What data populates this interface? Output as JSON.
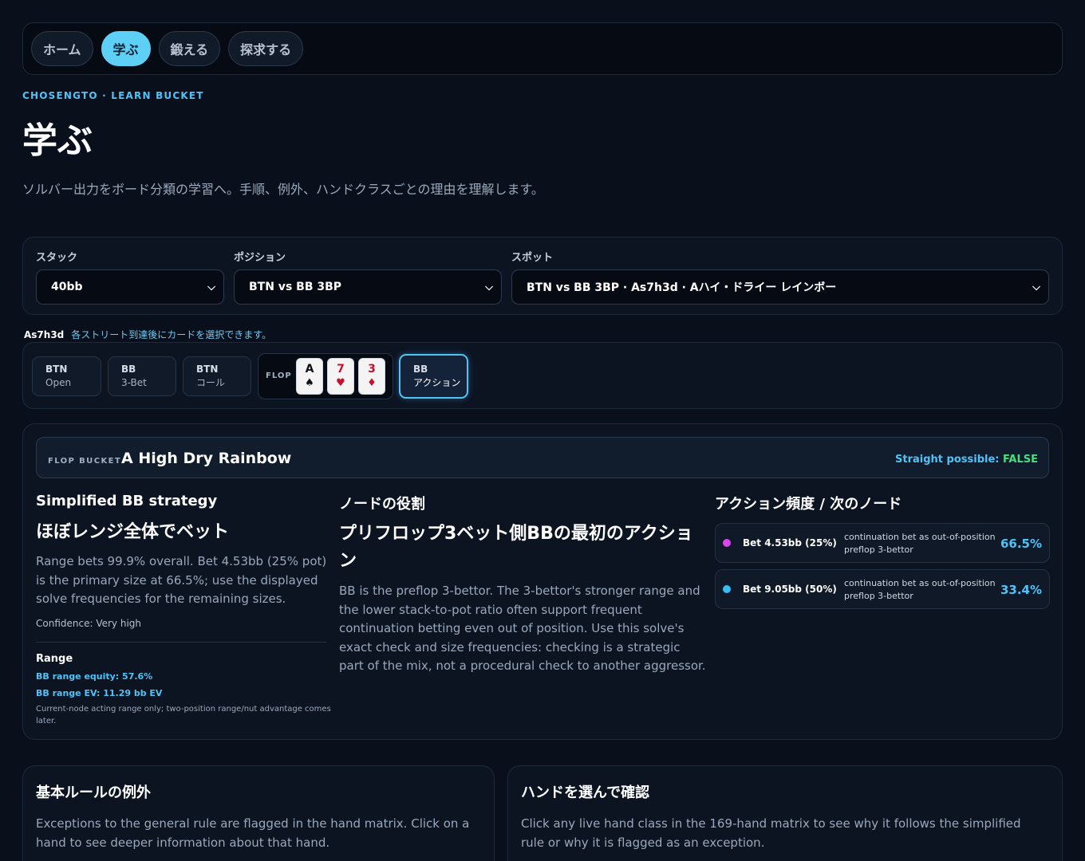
{
  "nav": {
    "items": [
      {
        "label": "ホーム",
        "active": false
      },
      {
        "label": "学ぶ",
        "active": true
      },
      {
        "label": "鍛える",
        "active": false
      },
      {
        "label": "探求する",
        "active": false
      }
    ]
  },
  "header": {
    "eyebrow": "CHOSENGTO · LEARN BUCKET",
    "title": "学ぶ",
    "subtitle": "ソルバー出力をボード分類の学習へ。手順、例外、ハンドクラスごとの理由を理解します。"
  },
  "selectors": {
    "stack": {
      "label": "スタック",
      "value": "40bb"
    },
    "position": {
      "label": "ポジション",
      "value": "BTN vs BB 3BP"
    },
    "spot": {
      "label": "スポット",
      "value": "BTN vs BB 3BP · As7h3d · Aハイ・ドライー レインボー"
    }
  },
  "street": {
    "board": "As7h3d",
    "hint": "各ストリート到達後にカードを選択できます。"
  },
  "trail": {
    "steps": [
      {
        "position": "BTN",
        "action": "Open"
      },
      {
        "position": "BB",
        "action": "3-Bet"
      },
      {
        "position": "BTN",
        "action": "コール"
      }
    ],
    "flop_label": "FLOP",
    "flop_cards": [
      {
        "rank": "A",
        "suit": "♠",
        "color": "black"
      },
      {
        "rank": "7",
        "suit": "♥",
        "color": "red"
      },
      {
        "rank": "3",
        "suit": "♦",
        "color": "red"
      }
    ],
    "current": {
      "position": "BB",
      "action": "アクション"
    }
  },
  "bucket": {
    "kicker": "FLOP BUCKET",
    "name": "A High Dry Rainbow",
    "straight_label": "Straight possible:",
    "straight_value": "FALSE"
  },
  "strategy": {
    "heading": "Simplified BB strategy",
    "headline": "ほぼレンジ全体でベット",
    "body": "Range bets 99.9% overall. Bet 4.53bb (25% pot) is the primary size at 66.5%; use the displayed solve frequencies for the remaining sizes.",
    "confidence": "Confidence: Very high",
    "range_heading": "Range",
    "equity": "BB range equity: 57.6%",
    "ev": "BB range EV: 11.29 bb EV",
    "range_note": "Current-node acting range only; two-position range/nut advantage comes later."
  },
  "node_role": {
    "heading": "ノードの役割",
    "headline": "プリフロップ3ベット側BBの最初のアクション",
    "body": "BB is the preflop 3-bettor. The 3-bettor's stronger range and the lower stack-to-pot ratio often support frequent continuation betting even out of position. Use this solve's exact check and size frequencies: checking is a strategic part of the mix, not a procedural check to another aggressor."
  },
  "frequencies": {
    "heading": "アクション頻度 / 次のノード",
    "rows": [
      {
        "label": "Bet 4.53bb (25%)",
        "description": "continuation bet as out-of-position preflop 3-bettor",
        "pct": "66.5%",
        "frequency": 0.665,
        "color": "#d946ef"
      },
      {
        "label": "Bet 9.05bb (50%)",
        "description": "continuation bet as out-of-position preflop 3-bettor",
        "pct": "33.4%",
        "frequency": 0.334,
        "color": "#38bdf8"
      }
    ]
  },
  "exceptions": {
    "heading": "基本ルールの例外",
    "body": "Exceptions to the general rule are flagged in the hand matrix. Click on a hand to see deeper information about that hand."
  },
  "hand_pick": {
    "heading": "ハンドを選んで確認",
    "body": "Click any live hand class in the 169-hand matrix to see why it follows the simplified rule or why it is flagged as an exception."
  }
}
